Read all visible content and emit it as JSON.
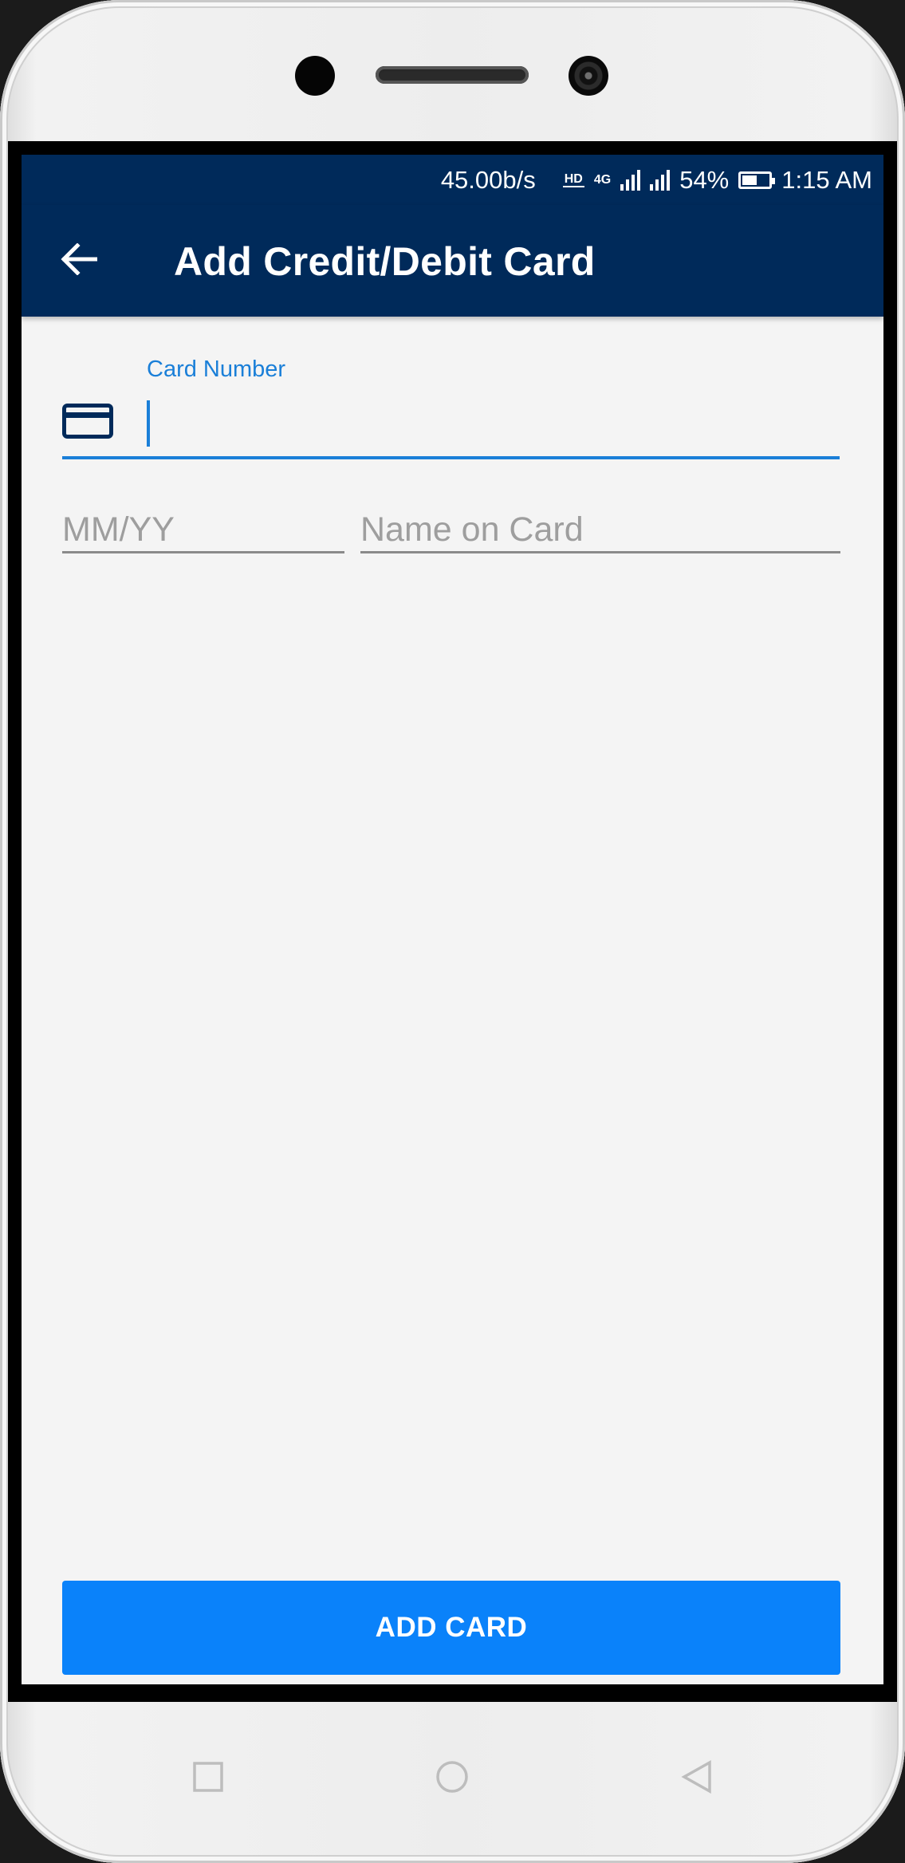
{
  "status_bar": {
    "network_speed": "45.00b/s",
    "hd_badge": "HD",
    "network_type": "4G",
    "battery_percent": "54%",
    "time": "1:15 AM"
  },
  "app_bar": {
    "title": "Add Credit/Debit Card"
  },
  "form": {
    "card_number": {
      "label": "Card Number",
      "value": ""
    },
    "expiry": {
      "placeholder": "MM/YY"
    },
    "name_on_card": {
      "placeholder": "Name on Card"
    },
    "submit_label": "ADD CARD"
  },
  "colors": {
    "primary_dark": "#002a5a",
    "accent": "#1a7fd8",
    "button": "#0a82fa"
  },
  "icons": {
    "back": "arrow-left-icon",
    "card": "credit-card-icon",
    "recent": "square-icon",
    "home": "circle-icon",
    "nav_back": "triangle-left-icon"
  }
}
